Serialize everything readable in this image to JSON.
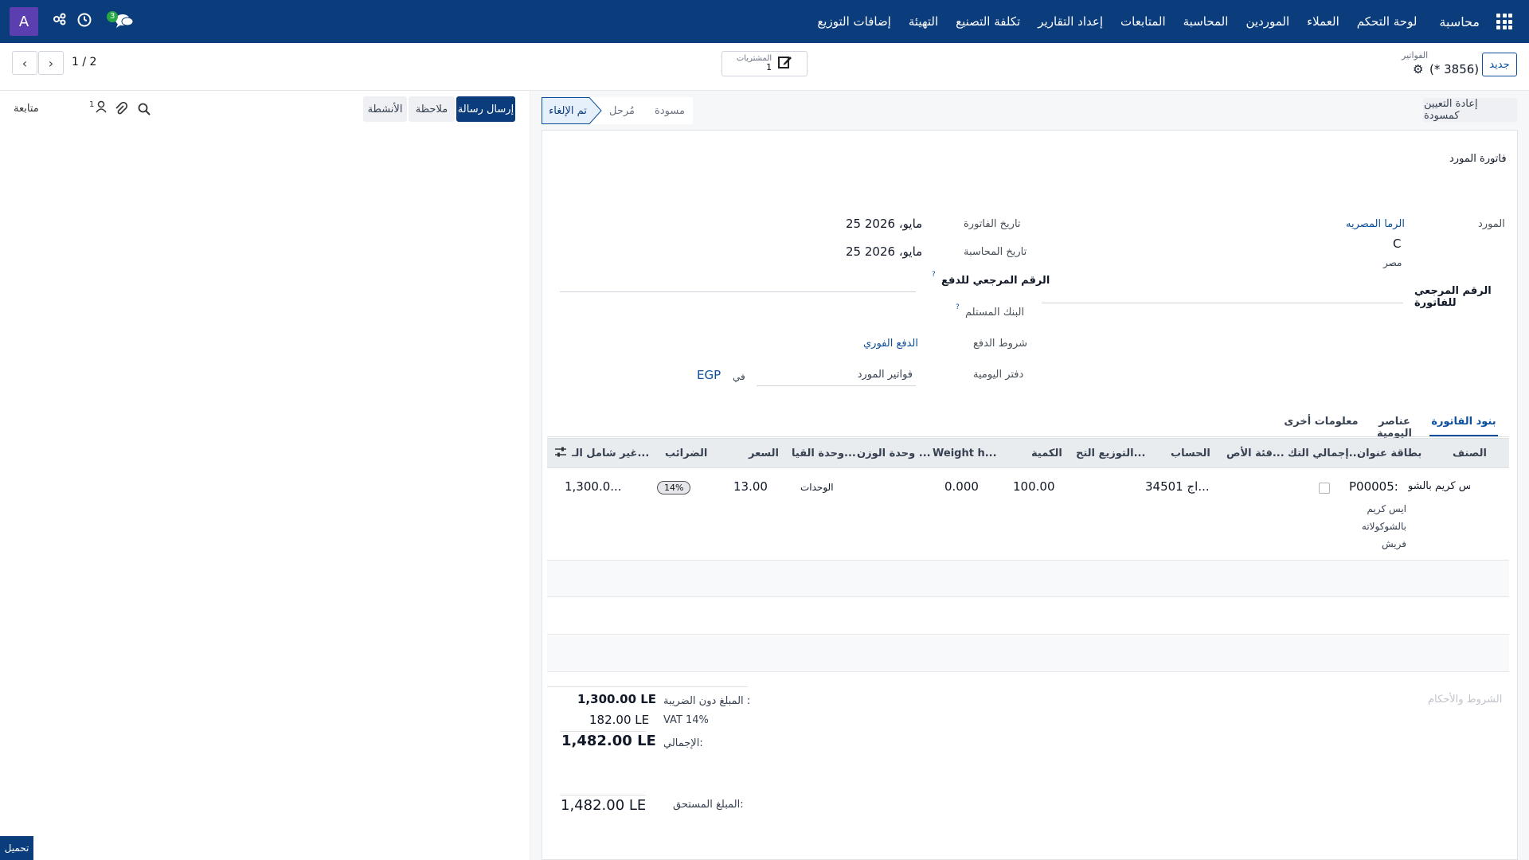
{
  "topbar": {
    "brand": "محاسبة",
    "menu": [
      "لوحة التحكم",
      "العملاء",
      "الموردين",
      "المحاسبة",
      "المتابعات",
      "إعداد التقارير",
      "تكلفة التصنيع",
      "التهيئة",
      "إضافات التوزيع"
    ],
    "avatar": "A",
    "chat_badge": "3"
  },
  "control": {
    "new_button": "جديد",
    "breadcrumb": "الفواتير",
    "record_name": "(* 3856)",
    "smart_button_label": "المشتريات",
    "smart_button_count": "1",
    "pager": "1 / 2"
  },
  "statusbar": {
    "reset_button": "إعادة التعيين كمسودة",
    "stages": [
      "مسودة",
      "مُرحل",
      "تم الإلغاء"
    ],
    "active_stage": "تم الإلغاء"
  },
  "chatter": {
    "send_message": "إرسال رسالة",
    "note": "ملاحظة",
    "activities": "الأنشطة",
    "followers_count": "1",
    "follow": "متابعة"
  },
  "form": {
    "title": "فاتورة المورد",
    "vendor_label": "المورد",
    "vendor_name": "الرما المصريه",
    "vendor_line2": "C",
    "vendor_country": "مصر",
    "invoice_ref_label": "الرقم المرجعي للفاتورة",
    "invoice_date_label": "تاريخ الفاتورة",
    "invoice_date": "25 مايو، 2026",
    "accounting_date_label": "تاريخ المحاسبة",
    "accounting_date": "25 مايو، 2026",
    "payment_ref_label": "الرقم المرجعي للدفع",
    "recipient_bank_label": "البنك المستلم",
    "payment_terms_label": "شروط الدفع",
    "payment_terms": "الدفع الفوري",
    "journal_label": "دفتر اليومية",
    "journal": "فواتير المورد",
    "in_label": "في",
    "currency": "EGP",
    "help_mark": "?"
  },
  "tabs": [
    "بنود الفاتورة",
    "عناصر اليومية",
    "معلومات أخرى"
  ],
  "table": {
    "headers": [
      "الصنف",
      "بطاقة عنوان",
      "إجمالي التك...",
      "فئة الأص...",
      "الحساب",
      "التوزيع التح...",
      "الكمية",
      "Weight h...",
      "وحدة الوزن ...",
      "وحدة القيا...",
      "السعر",
      "الضرائب",
      "غير شامل الـ..."
    ],
    "row": {
      "product": "ايس كريم بالشو",
      "label_code": "P00005:",
      "label_desc_1": "ايس كريم",
      "label_desc_2": "بالشوكولاته",
      "label_desc_3": "فريش",
      "account": "34501 اج...",
      "quantity": "100.00",
      "weight": "0.000",
      "uom": "الوحدات",
      "price": "13.00",
      "tax": "14%",
      "subtotal": "1,300.0..."
    }
  },
  "totals": {
    "terms_placeholder": "الشروط والأحكام",
    "untaxed_label": "المبلغ دون الضريبة :",
    "untaxed": "1,300.00 LE",
    "vat_label": "VAT 14%",
    "vat": "182.00 LE",
    "total_label": "الإجمالي:",
    "total": "1,482.00 LE",
    "due_label": "المبلغ المستحق:",
    "due": "1,482.00 LE"
  },
  "footer": {
    "upload": "تحميل"
  }
}
